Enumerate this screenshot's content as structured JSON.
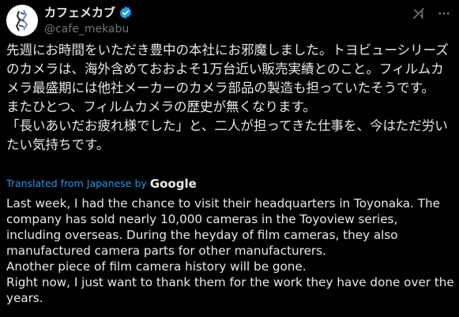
{
  "post": {
    "author": {
      "display_name": "カフェメカブ",
      "handle": "@cafe_mekabu",
      "verified": true
    },
    "icons": {
      "verified": "verified-badge-icon",
      "grok": "grok-icon",
      "more": "more-options-icon"
    },
    "colors": {
      "accent": "#1d9bf0",
      "background": "#000000",
      "text": "#e7e9ea",
      "secondary_text": "#71767b"
    },
    "original_text": "先週にお時間をいただき豊中の本社にお邪魔しました。トヨビューシリーズのカメラは、海外含めておおよそ1万台近い販売実績とのこと。フィルムカメラ最盛期には他社メーカーのカメラ部品の製造も担っていたそうです。\nまたひとつ、フィルムカメラの歴史が無くなります。\n「長いあいだお疲れ様でした」と、二人が担ってきた仕事を、今はただ労いたい気持ちです。",
    "translation_label": "Translated from Japanese by",
    "translation_provider": "Google",
    "translated_lines": [
      "Last week, I had the chance to visit their headquarters in Toyonaka. The company has sold nearly 10,000 cameras in the Toyoview series, including overseas. During the heyday of film cameras, they also manufactured camera parts for other manufacturers.",
      "Another piece of film camera history will be gone.",
      "Right now, I just want to thank them for the work they have done over the years."
    ]
  }
}
